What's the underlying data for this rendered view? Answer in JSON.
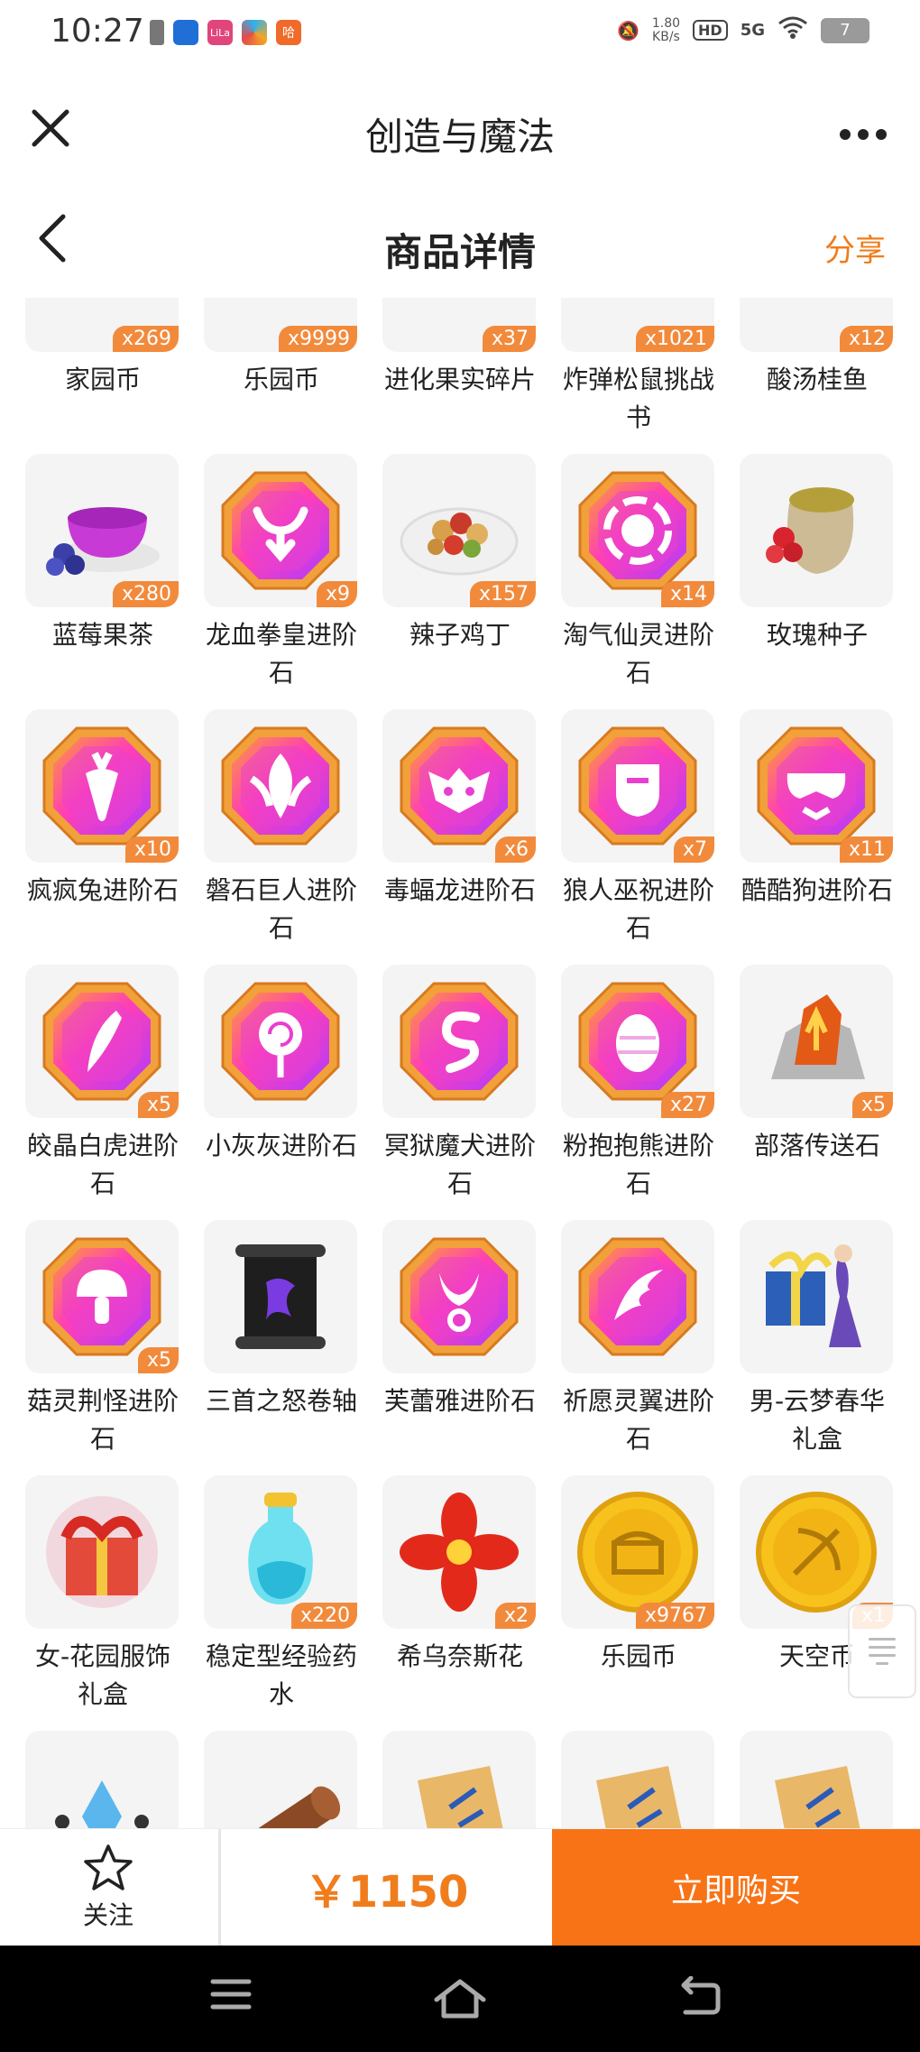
{
  "status_bar": {
    "time": "10:27",
    "speed_value": "1.80",
    "speed_unit": "KB/s",
    "hd": "HD",
    "network": "5G",
    "battery": "7",
    "app_icon_texts": [
      "",
      "LiLa",
      "",
      "哈"
    ]
  },
  "header": {
    "app_title": "创造与魔法",
    "page_title": "商品详情",
    "share_label": "分享"
  },
  "items": [
    {
      "name": "家园币",
      "qty": "x269",
      "icon": "gold-coin"
    },
    {
      "name": "乐园币",
      "qty": "x9999",
      "icon": "gold-coin"
    },
    {
      "name": "进化果实碎片",
      "qty": "x37",
      "icon": "purple-fruit"
    },
    {
      "name": "炸弹松鼠挑战书",
      "qty": "x1021",
      "icon": "brown-scroll"
    },
    {
      "name": "酸汤桂鱼",
      "qty": "x12",
      "icon": "fish-dish"
    },
    {
      "name": "蓝莓果茶",
      "qty": "x280",
      "icon": "tea-cup"
    },
    {
      "name": "龙血拳皇进阶石",
      "qty": "x9",
      "icon": "gem-bull"
    },
    {
      "name": "辣子鸡丁",
      "qty": "x157",
      "icon": "food-plate"
    },
    {
      "name": "淘气仙灵进阶石",
      "qty": "x14",
      "icon": "gem-swirl"
    },
    {
      "name": "玫瑰种子",
      "qty": "",
      "icon": "seed-sack"
    },
    {
      "name": "疯疯兔进阶石",
      "qty": "x10",
      "icon": "gem-carrot"
    },
    {
      "name": "磐石巨人进阶石",
      "qty": "",
      "icon": "gem-leaf"
    },
    {
      "name": "毒蝠龙进阶石",
      "qty": "x6",
      "icon": "gem-bat"
    },
    {
      "name": "狼人巫祝进阶石",
      "qty": "x7",
      "icon": "gem-mask"
    },
    {
      "name": "酷酷狗进阶石",
      "qty": "x11",
      "icon": "gem-goggles"
    },
    {
      "name": "皎晶白虎进阶石",
      "qty": "x5",
      "icon": "gem-claw"
    },
    {
      "name": "小灰灰进阶石",
      "qty": "",
      "icon": "gem-lollipop"
    },
    {
      "name": "冥狱魔犬进阶石",
      "qty": "",
      "icon": "gem-s"
    },
    {
      "name": "粉抱抱熊进阶石",
      "qty": "x27",
      "icon": "gem-egg"
    },
    {
      "name": "部落传送石",
      "qty": "x5",
      "icon": "portal-stone"
    },
    {
      "name": "菇灵荆怪进阶石",
      "qty": "x5",
      "icon": "gem-mushroom"
    },
    {
      "name": "三首之怒卷轴",
      "qty": "",
      "icon": "black-scroll"
    },
    {
      "name": "芙蕾雅进阶石",
      "qty": "",
      "icon": "gem-horns"
    },
    {
      "name": "祈愿灵翼进阶石",
      "qty": "",
      "icon": "gem-wing"
    },
    {
      "name": "男-云梦春华礼盒",
      "qty": "",
      "icon": "gift-box-blue"
    },
    {
      "name": "女-花园服饰礼盒",
      "qty": "",
      "icon": "gift-box-red"
    },
    {
      "name": "稳定型经验药水",
      "qty": "x220",
      "icon": "potion"
    },
    {
      "name": "希乌奈斯花",
      "qty": "x2",
      "icon": "red-flower"
    },
    {
      "name": "乐园币",
      "qty": "x9767",
      "icon": "gold-coin-chest"
    },
    {
      "name": "天空币",
      "qty": "x1",
      "icon": "gold-coin-bow"
    },
    {
      "name": "",
      "qty": "",
      "icon": "crystal-emblem"
    },
    {
      "name": "",
      "qty": "",
      "icon": "wood-log"
    },
    {
      "name": "",
      "qty": "",
      "icon": "map-scroll"
    },
    {
      "name": "",
      "qty": "",
      "icon": "map-scroll"
    },
    {
      "name": "",
      "qty": "",
      "icon": "map-scroll"
    }
  ],
  "action_bar": {
    "follow_label": "关注",
    "price": "￥1150",
    "buy_label": "立即购买"
  },
  "colors": {
    "accent": "#f87316",
    "price": "#f07c1c",
    "qty_badge": "#f28a3c"
  }
}
